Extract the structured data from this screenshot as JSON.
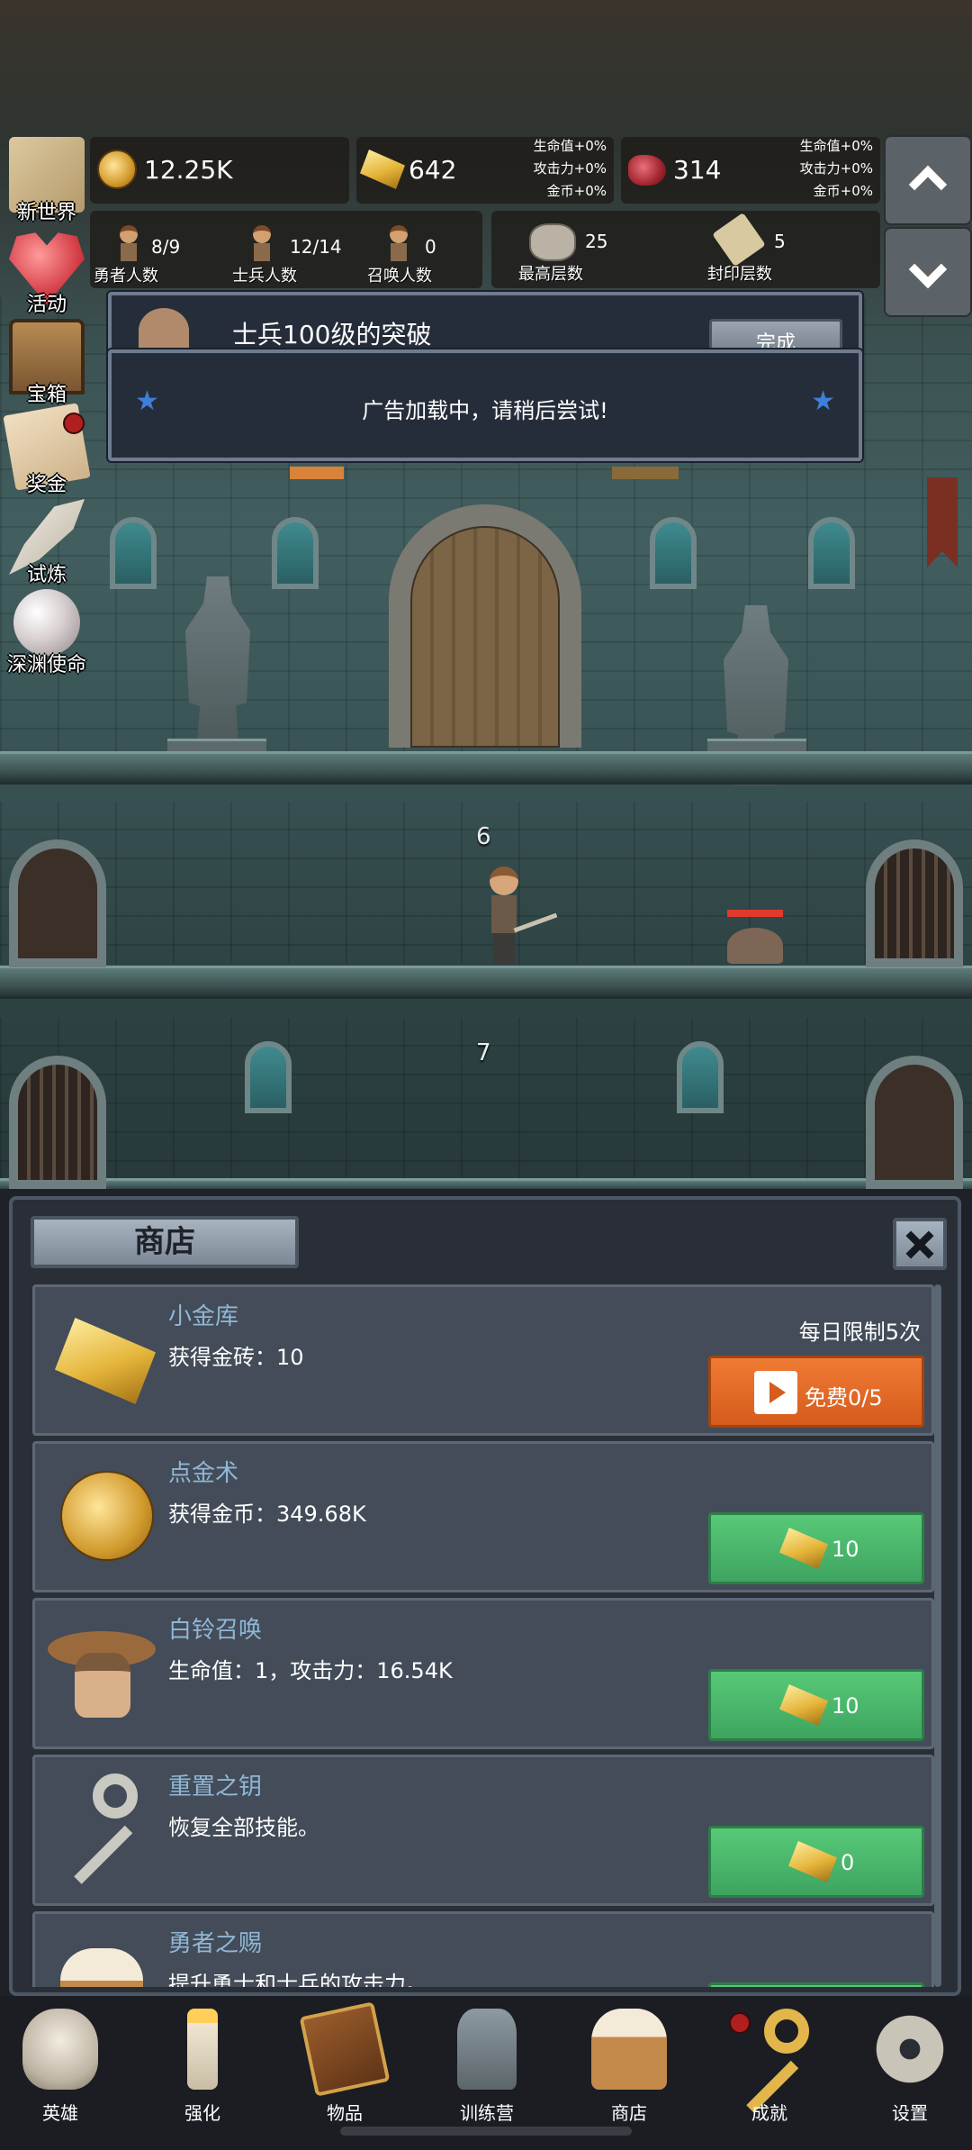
{
  "resources": {
    "gold_coins": "12.25K",
    "gold_bars": "642",
    "gold_bars_bonus": [
      "生命值+0%",
      "攻击力+0%",
      "金币+0%"
    ],
    "meat": "314",
    "meat_bonus": [
      "生命值+0%",
      "攻击力+0%",
      "金币+0%"
    ]
  },
  "stats": {
    "heroes": {
      "value": "8/9",
      "label": "勇者人数"
    },
    "soldiers": {
      "value": "12/14",
      "label": "士兵人数"
    },
    "summons": {
      "value": "0",
      "label": "召唤人数"
    },
    "highest_floor": {
      "value": "25",
      "label": "最高层数"
    },
    "sealed_floor": {
      "value": "5",
      "label": "封印层数"
    }
  },
  "side_menu": [
    {
      "label": "新世界",
      "icon": "map-icon"
    },
    {
      "label": "活动",
      "icon": "heart-icon"
    },
    {
      "label": "宝箱",
      "icon": "chest-icon"
    },
    {
      "label": "奖金",
      "icon": "envelope-icon"
    },
    {
      "label": "试炼",
      "icon": "feather-icon"
    },
    {
      "label": "深渊使命",
      "icon": "pearl-icon"
    }
  ],
  "notifications": {
    "quest_title": "士兵100级的突破",
    "quest_button": "完成",
    "ad_message": "广告加载中，请稍后尝试!"
  },
  "floors": [
    "6",
    "7"
  ],
  "shop": {
    "title": "商店",
    "items": [
      {
        "name": "小金库",
        "desc": "获得金砖：10",
        "limit": "每日限制5次",
        "button": "免费0/5",
        "button_type": "ad"
      },
      {
        "name": "点金术",
        "desc": "获得金币：349.68K",
        "button": "10",
        "button_type": "gold"
      },
      {
        "name": "白铃召唤",
        "desc": "生命值：1，攻击力：16.54K",
        "button": "10",
        "button_type": "gold"
      },
      {
        "name": "重置之钥",
        "desc": "恢复全部技能。",
        "button": "0",
        "button_type": "gold"
      },
      {
        "name": "勇者之赐",
        "desc": "提升勇士和士兵的攻击力。",
        "button": "",
        "button_type": "gold"
      }
    ]
  },
  "bottom_nav": [
    {
      "label": "英雄",
      "icon": "skull-icon"
    },
    {
      "label": "强化",
      "icon": "candle-icon"
    },
    {
      "label": "物品",
      "icon": "book-icon"
    },
    {
      "label": "训练营",
      "icon": "lantern-icon"
    },
    {
      "label": "商店",
      "icon": "mug-icon"
    },
    {
      "label": "成就",
      "icon": "key-icon"
    },
    {
      "label": "设置",
      "icon": "gear-icon"
    }
  ],
  "colors": {
    "accent_blue": "#8fb7d6",
    "buy_green": "#4cb86b",
    "ad_orange": "#e2672a",
    "alert_red": "#b01e1e"
  }
}
